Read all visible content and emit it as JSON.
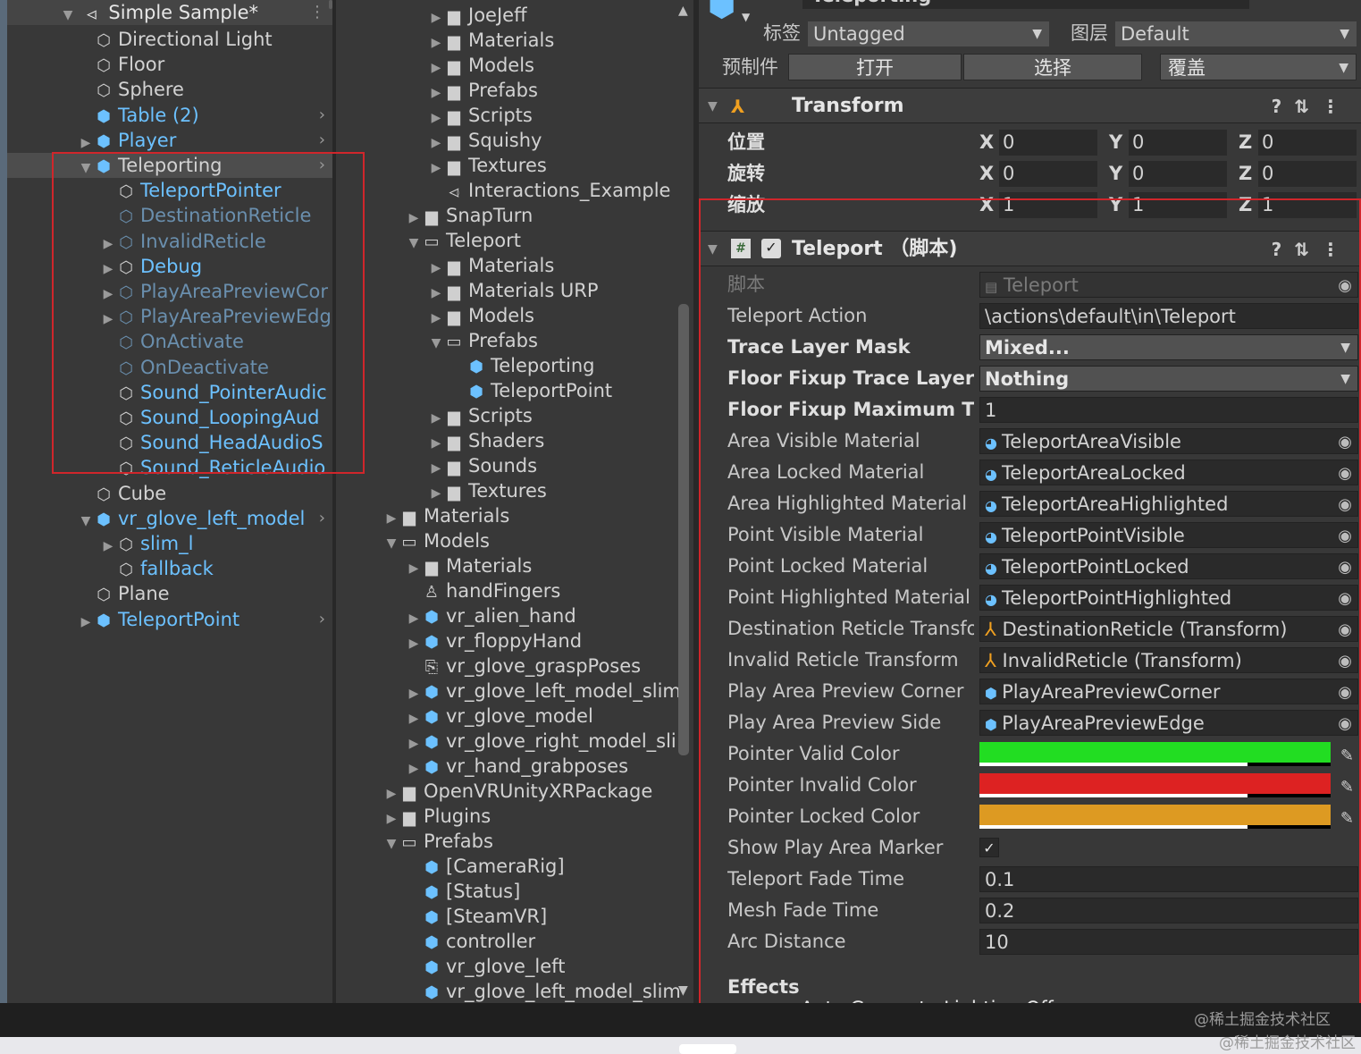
{
  "hierarchy": {
    "scene_title": "Simple Sample*",
    "rows": [
      {
        "label": "Directional Light",
        "indent": 1,
        "icon": "cube",
        "color": "normal",
        "arrow": "",
        "chev": false
      },
      {
        "label": "Floor",
        "indent": 1,
        "icon": "cube",
        "color": "normal",
        "arrow": "",
        "chev": false
      },
      {
        "label": "Sphere",
        "indent": 1,
        "icon": "cube",
        "color": "normal",
        "arrow": "",
        "chev": false
      },
      {
        "label": "Table (2)",
        "indent": 1,
        "icon": "pcube",
        "color": "blue",
        "arrow": "",
        "chev": true
      },
      {
        "label": "Player",
        "indent": 1,
        "icon": "pcube",
        "color": "blue",
        "arrow": "right",
        "chev": true
      },
      {
        "label": "Teleporting",
        "indent": 1,
        "icon": "pcube",
        "color": "normal",
        "arrow": "down",
        "chev": true,
        "selected": true
      },
      {
        "label": "TeleportPointer",
        "indent": 2,
        "icon": "cube",
        "color": "blue",
        "arrow": "",
        "chev": false
      },
      {
        "label": "DestinationReticle",
        "indent": 2,
        "icon": "cube",
        "color": "dim",
        "arrow": "",
        "chev": false
      },
      {
        "label": "InvalidReticle",
        "indent": 2,
        "icon": "cube",
        "color": "dim",
        "arrow": "right",
        "chev": false
      },
      {
        "label": "Debug",
        "indent": 2,
        "icon": "cube",
        "color": "blue",
        "arrow": "right",
        "chev": false
      },
      {
        "label": "PlayAreaPreviewCor",
        "indent": 2,
        "icon": "cube",
        "color": "dim",
        "arrow": "right",
        "chev": false
      },
      {
        "label": "PlayAreaPreviewEdg",
        "indent": 2,
        "icon": "cube",
        "color": "dim",
        "arrow": "right",
        "chev": false
      },
      {
        "label": "OnActivate",
        "indent": 2,
        "icon": "cube",
        "color": "dim",
        "arrow": "",
        "chev": false
      },
      {
        "label": "OnDeactivate",
        "indent": 2,
        "icon": "cube",
        "color": "dim",
        "arrow": "",
        "chev": false
      },
      {
        "label": "Sound_PointerAudic",
        "indent": 2,
        "icon": "cube",
        "color": "blue",
        "arrow": "",
        "chev": false
      },
      {
        "label": "Sound_LoopingAud",
        "indent": 2,
        "icon": "cube",
        "color": "blue",
        "arrow": "",
        "chev": false
      },
      {
        "label": "Sound_HeadAudioS",
        "indent": 2,
        "icon": "cube",
        "color": "blue",
        "arrow": "",
        "chev": false
      },
      {
        "label": "Sound_ReticleAudio",
        "indent": 2,
        "icon": "cube",
        "color": "blue",
        "arrow": "",
        "chev": false
      },
      {
        "label": "Cube",
        "indent": 1,
        "icon": "cube",
        "color": "normal",
        "arrow": "",
        "chev": false
      },
      {
        "label": "vr_glove_left_model",
        "indent": 1,
        "icon": "pcube",
        "color": "blue",
        "arrow": "down",
        "chev": true
      },
      {
        "label": "slim_l",
        "indent": 2,
        "icon": "cube",
        "color": "blue",
        "arrow": "right",
        "chev": false
      },
      {
        "label": "fallback",
        "indent": 2,
        "icon": "cube",
        "color": "blue",
        "arrow": "",
        "chev": false
      },
      {
        "label": "Plane",
        "indent": 1,
        "icon": "cube",
        "color": "normal",
        "arrow": "",
        "chev": false
      },
      {
        "label": "TeleportPoint",
        "indent": 1,
        "icon": "pcube",
        "color": "blue",
        "arrow": "right",
        "chev": true
      }
    ]
  },
  "project": {
    "rows": [
      {
        "label": "JoeJeff",
        "indent": 2,
        "icon": "folder",
        "arrow": "right"
      },
      {
        "label": "Materials",
        "indent": 2,
        "icon": "folder",
        "arrow": "right"
      },
      {
        "label": "Models",
        "indent": 2,
        "icon": "folder",
        "arrow": "right"
      },
      {
        "label": "Prefabs",
        "indent": 2,
        "icon": "folder",
        "arrow": "right"
      },
      {
        "label": "Scripts",
        "indent": 2,
        "icon": "folder",
        "arrow": "right"
      },
      {
        "label": "Squishy",
        "indent": 2,
        "icon": "folder",
        "arrow": "right"
      },
      {
        "label": "Textures",
        "indent": 2,
        "icon": "folder",
        "arrow": "right"
      },
      {
        "label": "Interactions_Example",
        "indent": 2,
        "icon": "scene",
        "arrow": ""
      },
      {
        "label": "SnapTurn",
        "indent": 1,
        "icon": "folder",
        "arrow": "right"
      },
      {
        "label": "Teleport",
        "indent": 1,
        "icon": "folderopen",
        "arrow": "down"
      },
      {
        "label": "Materials",
        "indent": 2,
        "icon": "folder",
        "arrow": "right"
      },
      {
        "label": "Materials URP",
        "indent": 2,
        "icon": "folder",
        "arrow": "right"
      },
      {
        "label": "Models",
        "indent": 2,
        "icon": "folder",
        "arrow": "right"
      },
      {
        "label": "Prefabs",
        "indent": 2,
        "icon": "folderopen",
        "arrow": "down"
      },
      {
        "label": "Teleporting",
        "indent": 3,
        "icon": "pcube",
        "arrow": ""
      },
      {
        "label": "TeleportPoint",
        "indent": 3,
        "icon": "pcube",
        "arrow": ""
      },
      {
        "label": "Scripts",
        "indent": 2,
        "icon": "folder",
        "arrow": "right"
      },
      {
        "label": "Shaders",
        "indent": 2,
        "icon": "folder",
        "arrow": "right"
      },
      {
        "label": "Sounds",
        "indent": 2,
        "icon": "folder",
        "arrow": "right"
      },
      {
        "label": "Textures",
        "indent": 2,
        "icon": "folder",
        "arrow": "right"
      },
      {
        "label": "Materials",
        "indent": 0,
        "icon": "folder",
        "arrow": "right"
      },
      {
        "label": "Models",
        "indent": 0,
        "icon": "folderopen",
        "arrow": "down"
      },
      {
        "label": "Materials",
        "indent": 1,
        "icon": "folder",
        "arrow": "right"
      },
      {
        "label": "handFingers",
        "indent": 1,
        "icon": "rig",
        "arrow": ""
      },
      {
        "label": "vr_alien_hand",
        "indent": 1,
        "icon": "pcube",
        "arrow": "right"
      },
      {
        "label": "vr_floppyHand",
        "indent": 1,
        "icon": "pcube",
        "arrow": "right"
      },
      {
        "label": "vr_glove_graspPoses",
        "indent": 1,
        "icon": "anim",
        "arrow": ""
      },
      {
        "label": "vr_glove_left_model_slim",
        "indent": 1,
        "icon": "pcube",
        "arrow": "right"
      },
      {
        "label": "vr_glove_model",
        "indent": 1,
        "icon": "pcube",
        "arrow": "right"
      },
      {
        "label": "vr_glove_right_model_sli",
        "indent": 1,
        "icon": "pcube",
        "arrow": "right"
      },
      {
        "label": "vr_hand_grabposes",
        "indent": 1,
        "icon": "pcube",
        "arrow": "right"
      },
      {
        "label": "OpenVRUnityXRPackage",
        "indent": 0,
        "icon": "folder",
        "arrow": "right"
      },
      {
        "label": "Plugins",
        "indent": 0,
        "icon": "folder",
        "arrow": "right"
      },
      {
        "label": "Prefabs",
        "indent": 0,
        "icon": "folderopen",
        "arrow": "down"
      },
      {
        "label": "[CameraRig]",
        "indent": 1,
        "icon": "pcube",
        "arrow": ""
      },
      {
        "label": "[Status]",
        "indent": 1,
        "icon": "pcube",
        "arrow": ""
      },
      {
        "label": "[SteamVR]",
        "indent": 1,
        "icon": "pcube",
        "arrow": ""
      },
      {
        "label": "controller",
        "indent": 1,
        "icon": "pcube",
        "arrow": ""
      },
      {
        "label": "vr_glove_left",
        "indent": 1,
        "icon": "pcube",
        "arrow": ""
      },
      {
        "label": "vr_glove_left_model_slim",
        "indent": 1,
        "icon": "pcube",
        "arrow": ""
      }
    ]
  },
  "inspector": {
    "name_partial": "Teleporting",
    "tag_label": "标签",
    "tag_value": "Untagged",
    "layer_label": "图层",
    "layer_value": "Default",
    "prefab_label": "预制件",
    "prefab_open": "打开",
    "prefab_select": "选择",
    "prefab_override": "覆盖",
    "transform": {
      "title": "Transform",
      "rows": [
        {
          "label": "位置",
          "x": "0",
          "y": "0",
          "z": "0"
        },
        {
          "label": "旋转",
          "x": "0",
          "y": "0",
          "z": "0"
        },
        {
          "label": "缩放",
          "x": "1",
          "y": "1",
          "z": "1"
        }
      ]
    },
    "teleport": {
      "title": "Teleport （脚本)",
      "script_label": "脚本",
      "script_value": "Teleport",
      "fields": [
        {
          "label": "Teleport Action",
          "value": "\\actions\\default\\in\\Teleport",
          "kind": "text",
          "bold": false
        },
        {
          "label": "Trace Layer Mask",
          "value": "Mixed...",
          "kind": "drop",
          "bold": true
        },
        {
          "label": "Floor Fixup Trace Layer M",
          "value": "Nothing",
          "kind": "drop",
          "bold": true
        },
        {
          "label": "Floor Fixup Maximum Tra",
          "value": "1",
          "kind": "text",
          "bold": true
        },
        {
          "label": "Area Visible Material",
          "value": "TeleportAreaVisible",
          "kind": "mat",
          "bold": false
        },
        {
          "label": "Area Locked Material",
          "value": "TeleportAreaLocked",
          "kind": "mat",
          "bold": false
        },
        {
          "label": "Area Highlighted Material",
          "value": "TeleportAreaHighlighted",
          "kind": "mat",
          "bold": false
        },
        {
          "label": "Point Visible Material",
          "value": "TeleportPointVisible",
          "kind": "mat",
          "bold": false
        },
        {
          "label": "Point Locked Material",
          "value": "TeleportPointLocked",
          "kind": "mat",
          "bold": false
        },
        {
          "label": "Point Highlighted Material",
          "value": "TeleportPointHighlighted",
          "kind": "mat",
          "bold": false
        },
        {
          "label": "Destination Reticle Transfor",
          "value": "DestinationReticle (Transform)",
          "kind": "xform",
          "bold": false
        },
        {
          "label": "Invalid Reticle Transform",
          "value": "InvalidReticle (Transform)",
          "kind": "xform",
          "bold": false
        },
        {
          "label": "Play Area Preview Corner",
          "value": "PlayAreaPreviewCorner",
          "kind": "prefab",
          "bold": false
        },
        {
          "label": "Play Area Preview Side",
          "value": "PlayAreaPreviewEdge",
          "kind": "prefab",
          "bold": false
        }
      ],
      "colors": [
        {
          "label": "Pointer Valid Color",
          "hex": "#22dd22"
        },
        {
          "label": "Pointer Invalid Color",
          "hex": "#dd2222"
        },
        {
          "label": "Pointer Locked Color",
          "hex": "#dd9a22"
        }
      ],
      "show_play_area_label": "Show Play Area Marker",
      "show_play_area_checked": true,
      "numbers": [
        {
          "label": "Teleport Fade Time",
          "value": "0.1"
        },
        {
          "label": "Mesh Fade Time",
          "value": "0.2"
        },
        {
          "label": "Arc Distance",
          "value": "10"
        }
      ],
      "effects_label": "Effects",
      "auto_generate_label": "Auto Generate Lighting Off"
    }
  },
  "watermark": "@稀土掘金技术社区"
}
